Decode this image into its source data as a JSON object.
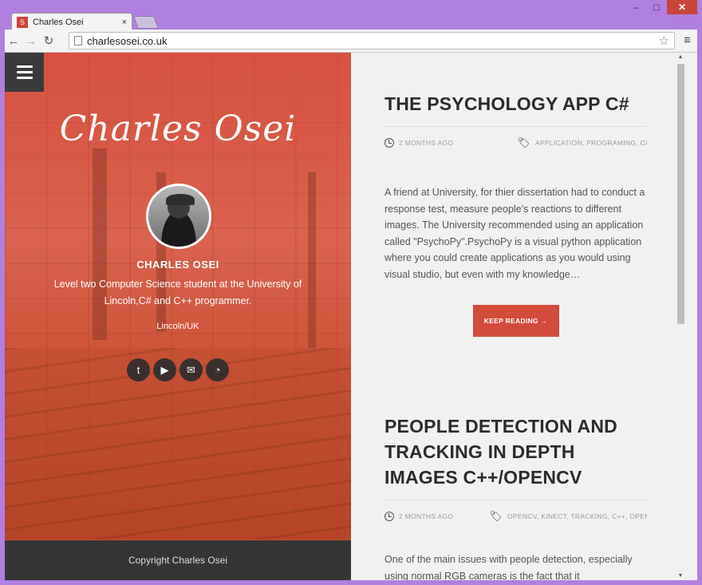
{
  "browser": {
    "tab_title": "Charles Osei",
    "favicon_letter": "S",
    "tab_close": "×",
    "url": "charlesosei.co.uk",
    "window_controls": [
      "–",
      "□",
      "✕"
    ]
  },
  "sidebar": {
    "site_title": "Charles Osei",
    "author_name": "CHARLES OSEI",
    "bio": "Level two Computer Science student at the University of Lincoln,C# and C++ programmer.",
    "location": "Lincoln/UK",
    "social_icons": [
      "twitter-icon",
      "youtube-icon",
      "email-icon",
      "rss-icon"
    ],
    "footer": "Copyright Charles Osei"
  },
  "posts": [
    {
      "title": "THE PSYCHOLOGY APP C#",
      "time": "2 MONTHS AGO",
      "tags": "APPLICATION, PROGRAMING, C#",
      "excerpt": "A friend at University, for thier dissertation had to conduct a response test, measure people’s reactions to different images. The University recommended using an application called \"PsychoPy\".PsychoPy is a visual python application where you could create applications as you would using visual studio, but even with my knowledge…",
      "button": "KEEP READING →"
    },
    {
      "title": "PEOPLE DETECTION AND TRACKING IN DEPTH IMAGES C++/OPENCV",
      "time": "2 MONTHS AGO",
      "tags": "OPENCV, KINECT, TRACKING, C++, OPENNI",
      "excerpt": "One of the main issues with people detection, especially using normal RGB cameras is the fact that it"
    }
  ]
}
